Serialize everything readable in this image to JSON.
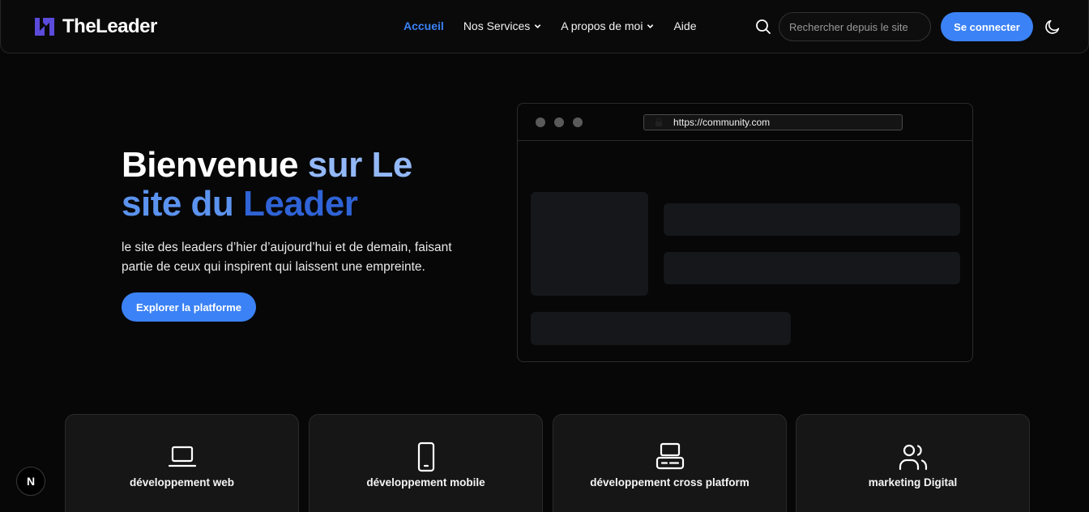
{
  "brand": {
    "name": "TheLeader"
  },
  "nav": {
    "items": [
      {
        "label": "Accueil",
        "active": true,
        "dropdown": false
      },
      {
        "label": "Nos Services",
        "active": false,
        "dropdown": true
      },
      {
        "label": "A propos de moi",
        "active": false,
        "dropdown": true
      },
      {
        "label": "Aide",
        "active": false,
        "dropdown": false
      }
    ]
  },
  "search": {
    "placeholder": "Rechercher depuis le site",
    "value": ""
  },
  "auth": {
    "login_label": "Se connecter"
  },
  "theme_toggle_icon": "moon-icon",
  "hero": {
    "title_part1": "Bienvenue",
    "title_part2": "sur Le",
    "title_part3": "site du",
    "title_part4": "Leader",
    "subtitle": "le site des leaders d’hier d’aujourd’hui et de demain, faisant partie de ceux qui inspirent qui laissent une empreinte.",
    "cta_label": "Explorer la platforme"
  },
  "browser_mock": {
    "url": "https://community.com"
  },
  "services": [
    {
      "label": "développement web",
      "icon": "laptop-icon"
    },
    {
      "label": "développement mobile",
      "icon": "smartphone-icon"
    },
    {
      "label": "développement cross platform",
      "icon": "devices-icon"
    },
    {
      "label": "marketing Digital",
      "icon": "users-icon"
    }
  ],
  "badge": {
    "label": "N"
  },
  "colors": {
    "accent": "#3b82f6",
    "background": "#070707",
    "card": "#161616"
  }
}
